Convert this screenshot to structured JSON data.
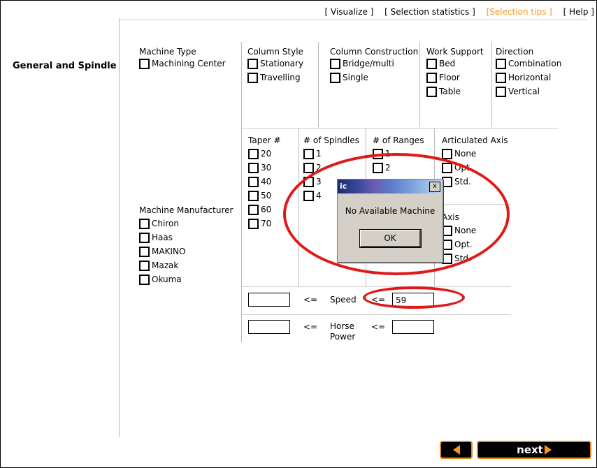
{
  "topnav": [
    "[ Visualize ]",
    "[ Selection statistics ]",
    "[Selection tips ]",
    "[ Help ]"
  ],
  "section_title": "General and Spindle",
  "groups": {
    "machine_type": {
      "label": "Machine Type",
      "options": [
        "Machining Center"
      ]
    },
    "column_style": {
      "label": "Column Style",
      "options": [
        "Stationary",
        "Travelling"
      ]
    },
    "column_construction": {
      "label": "Column Construction",
      "options": [
        "Bridge/multi",
        "Single"
      ]
    },
    "work_support": {
      "label": "Work Support",
      "options": [
        "Bed",
        "Floor",
        "Table"
      ]
    },
    "direction": {
      "label": "Direction",
      "options": [
        "Combination",
        "Horizontal",
        "Vertical"
      ]
    },
    "taper": {
      "label": "Taper #",
      "options": [
        "20",
        "30",
        "40",
        "50",
        "60",
        "70"
      ]
    },
    "spindles": {
      "label": "# of Spindles",
      "options": [
        "1",
        "2",
        "3",
        "4"
      ]
    },
    "ranges": {
      "label": "# of Ranges",
      "options": [
        "1",
        "2"
      ]
    },
    "articulated_axis": {
      "label": "Articulated Axis",
      "options": [
        "None",
        "Opt.",
        "Std."
      ]
    },
    "axis2": {
      "label": "Axis",
      "options": [
        "None",
        "Opt.",
        "Std."
      ]
    },
    "manufacturer": {
      "label": "Machine Manufacturer",
      "options": [
        "Chiron",
        "Haas",
        "MAKINO",
        "Mazak",
        "Okuma"
      ]
    }
  },
  "speed": {
    "min": "",
    "op1": "<=",
    "label": "Speed",
    "op2": "<=",
    "max": "59"
  },
  "horsepower": {
    "min": "",
    "op1": "<=",
    "label": "Horse Power",
    "op2": "<=",
    "max": ""
  },
  "dialog": {
    "title": "ic",
    "message": "No Available Machine",
    "ok_label": "OK",
    "close_label": "x"
  },
  "nav": {
    "next_label": "next"
  },
  "colors": {
    "accent": "#f7941d",
    "highlight": "#e01818"
  }
}
